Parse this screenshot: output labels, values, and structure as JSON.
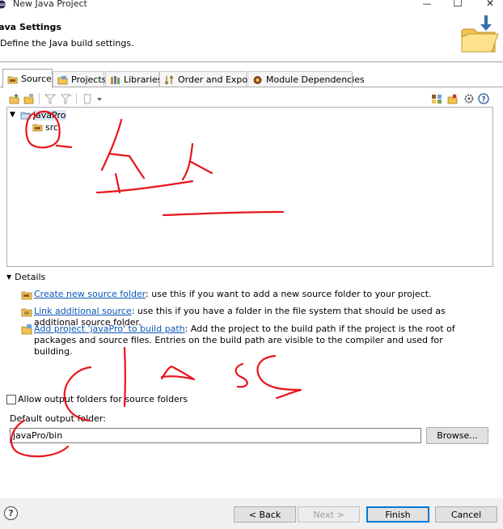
{
  "window": {
    "title": "New Java Project",
    "minimize_glyph": "—",
    "maximize_glyph": "☐",
    "close_glyph": "✕"
  },
  "header": {
    "heading": "Java Settings",
    "description": "Define the Java build settings."
  },
  "tabs": [
    {
      "label": "Source",
      "icon": "source-folder-icon",
      "active": true
    },
    {
      "label": "Projects",
      "icon": "projects-icon",
      "active": false
    },
    {
      "label": "Libraries",
      "icon": "libraries-icon",
      "active": false
    },
    {
      "label": "Order and Export",
      "icon": "order-export-icon",
      "active": false
    },
    {
      "label": "Module Dependencies",
      "icon": "module-dependencies-icon",
      "active": false
    }
  ],
  "tree": {
    "project": "javaPro",
    "children": [
      "src"
    ]
  },
  "details": {
    "title": "Details",
    "items": [
      {
        "link": "Create new source folder",
        "text": ": use this if you want to add a new source folder to your project."
      },
      {
        "link": "Link additional source",
        "text": ": use this if you have a folder in the file system that should be used as additional source folder."
      },
      {
        "link": "Add project 'javaPro' to build path",
        "text": ": Add the project to the build path if the project is the root of packages and source files. Entries on the build path are visible to the compiler and used for building."
      }
    ]
  },
  "output": {
    "allow_label": "Allow output folders for source folders",
    "allow_checked": false,
    "folder_label": "Default output folder:",
    "folder_value": "javaPro/bin",
    "browse_label": "Browse..."
  },
  "footer": {
    "help_glyph": "?",
    "back_label": "< Back",
    "next_label": "Next >",
    "finish_label": "Finish",
    "cancel_label": "Cancel"
  },
  "colors": {
    "link": "#0b57b6",
    "annotation": "#e8141c",
    "primary_border": "#0078d7"
  }
}
